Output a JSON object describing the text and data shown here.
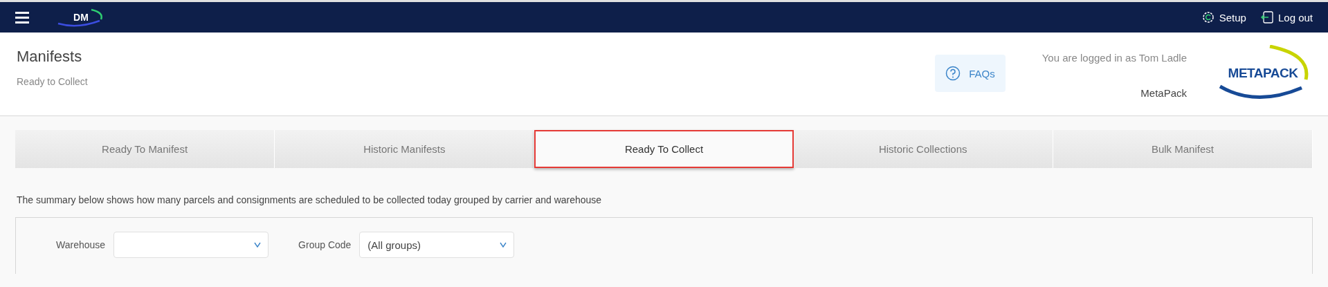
{
  "top_bar": {
    "logo_text": "DM",
    "setup": "Setup",
    "logout": "Log out"
  },
  "header": {
    "title": "Manifests",
    "subtitle": "Ready to Collect",
    "faq": "FAQs",
    "logged_in": "You are logged in as Tom Ladle",
    "company": "MetaPack",
    "brand_logo": "METAPACK"
  },
  "tabs": [
    {
      "label": "Ready To Manifest",
      "selected": false
    },
    {
      "label": "Historic Manifests",
      "selected": false
    },
    {
      "label": "Ready To Collect",
      "selected": true
    },
    {
      "label": "Historic Collections",
      "selected": false
    },
    {
      "label": "Bulk Manifest",
      "selected": false
    }
  ],
  "summary": "The summary below shows how many parcels and consignments are scheduled to be collected today grouped by carrier and warehouse",
  "filters": [
    {
      "label": "Warehouse"
    },
    {
      "label": "Group Code",
      "value": "(All groups)"
    }
  ]
}
